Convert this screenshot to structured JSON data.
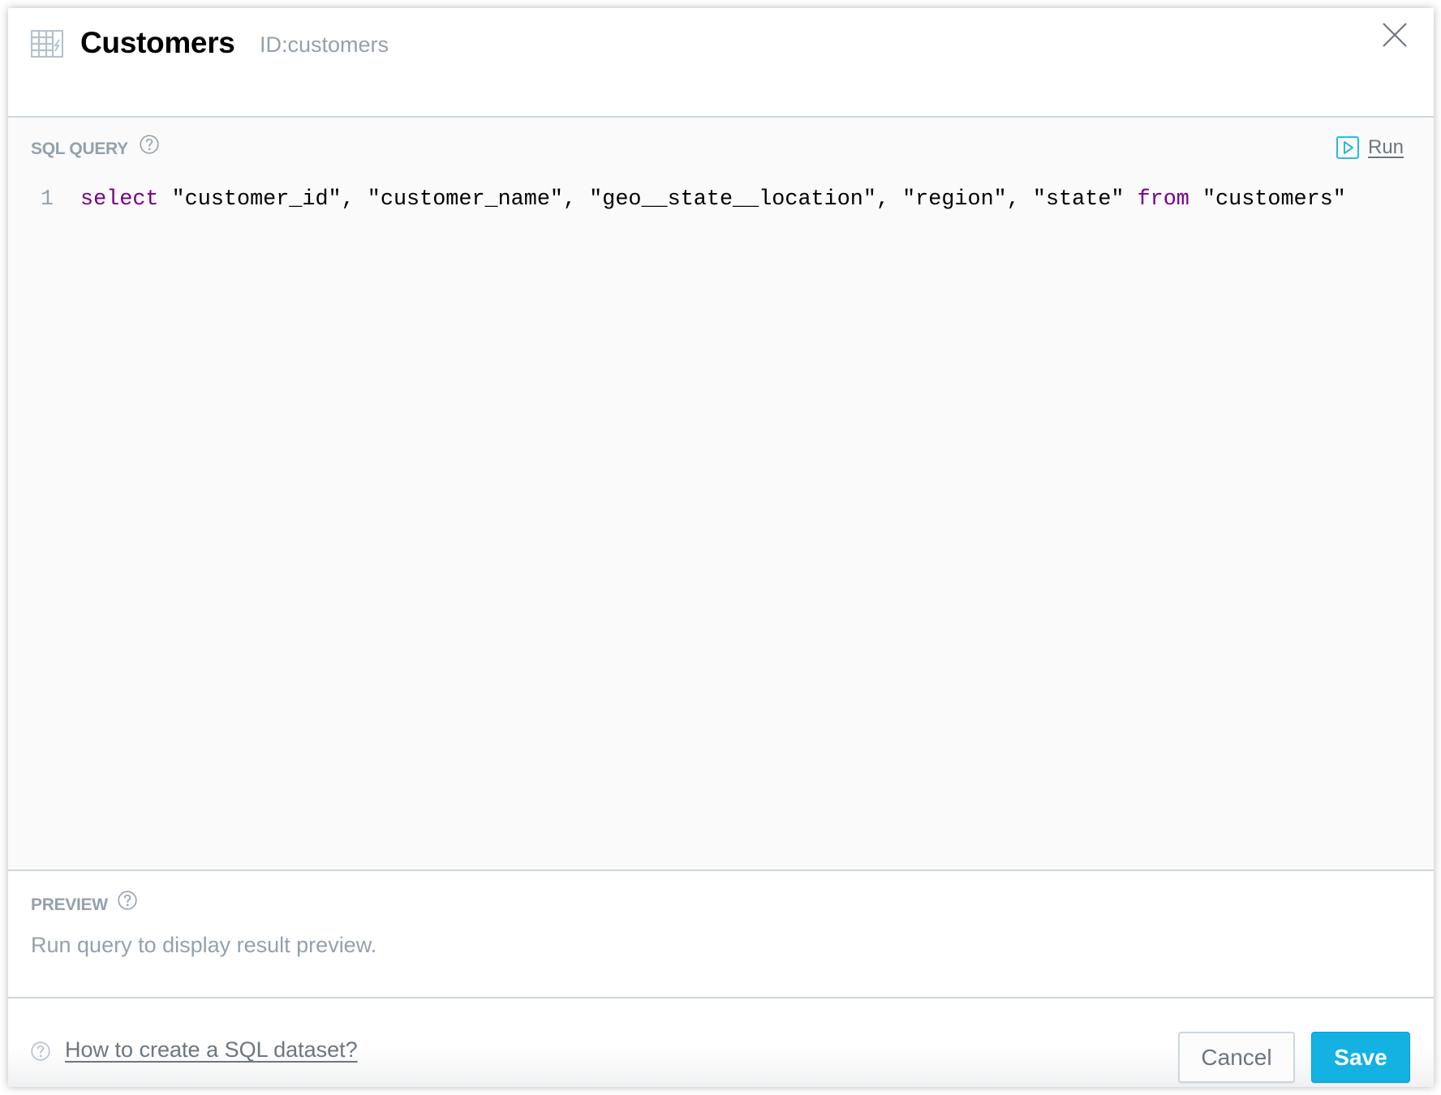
{
  "header": {
    "icon": "table-lightning-icon",
    "title": "Customers",
    "dataset_id": "ID:customers",
    "close_icon": "close-icon"
  },
  "sql_section": {
    "label": "SQL QUERY",
    "help_icon": "question-circle-icon",
    "run_label": "Run",
    "run_icon": "play-square-icon",
    "lines": [
      {
        "number": "1",
        "tokens": [
          {
            "text": "select",
            "type": "keyword"
          },
          {
            "text": " \"customer_id\", \"customer_name\", \"geo__state__location\", \"region\", \"state\" ",
            "type": "plain"
          },
          {
            "text": "from",
            "type": "keyword"
          },
          {
            "text": " \"customers\"",
            "type": "plain"
          }
        ]
      }
    ]
  },
  "preview_section": {
    "label": "PREVIEW",
    "help_icon": "question-circle-icon",
    "message": "Run query to display result preview."
  },
  "footer": {
    "help_icon": "question-circle-icon",
    "help_link": "How to create a SQL dataset?",
    "cancel_label": "Cancel",
    "save_label": "Save"
  },
  "colors": {
    "accent": "#14b2e2",
    "keyword": "#770088",
    "muted_text": "#94a1ad",
    "link_text": "#6d7680",
    "divider": "#ccd8e2"
  }
}
